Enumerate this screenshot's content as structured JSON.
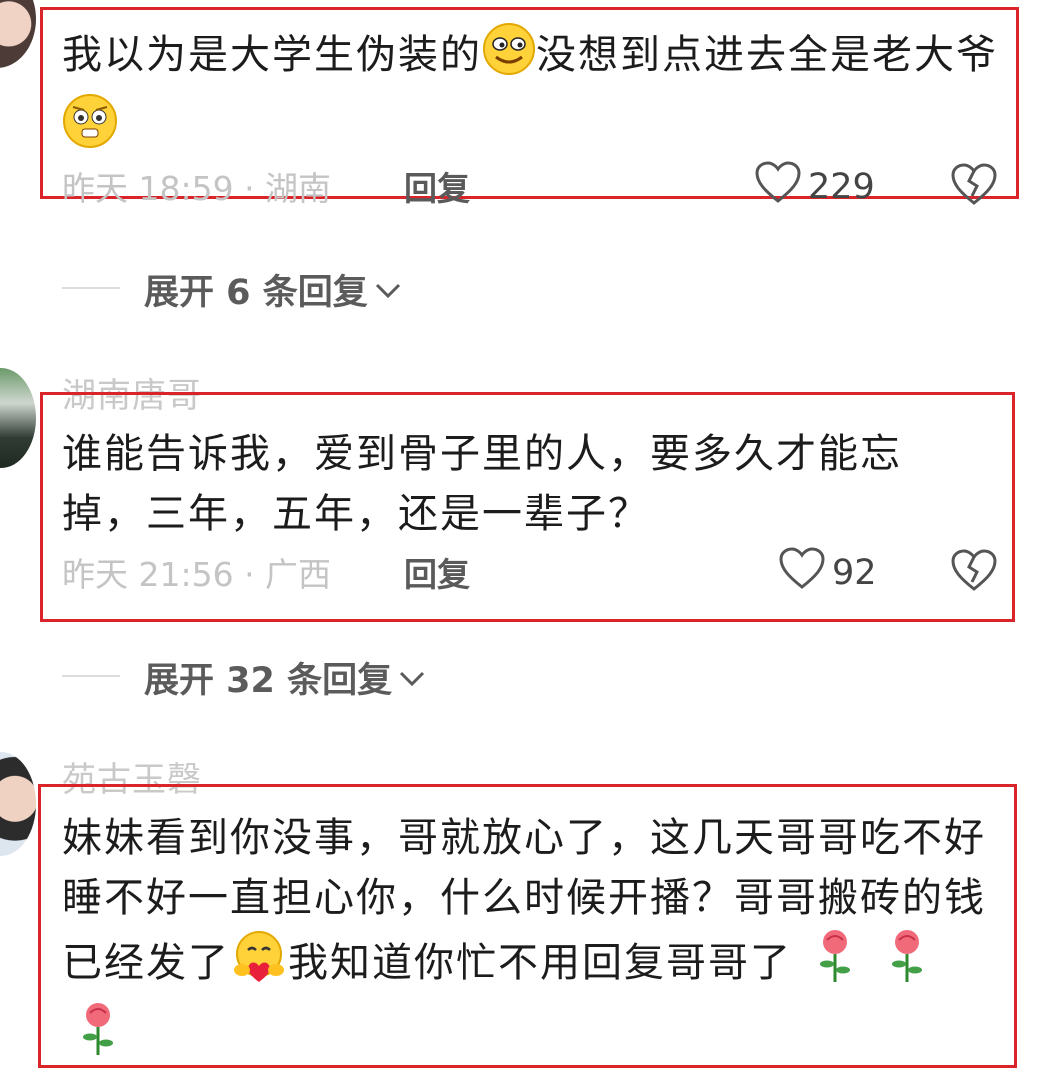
{
  "comments": [
    {
      "username": "",
      "text_parts": [
        "我以为是大学生伪装的",
        "没想到点进去全是老大爷"
      ],
      "emoji_icons": [
        "smirk-face-emoji",
        "pleading-face-emoji"
      ],
      "meta": "昨天 18:59 · 湖南",
      "reply_label": "回复",
      "likes": "229",
      "expand_label": "展开 6 条回复"
    },
    {
      "username": "湖南唐哥",
      "text": "谁能告诉我，爱到骨子里的人，要多久才能忘掉，三年，五年，还是一辈子？",
      "meta": "昨天 21:56 · 广西",
      "reply_label": "回复",
      "likes": "92",
      "expand_label": "展开 32 条回复"
    },
    {
      "username": "苑古玉磬",
      "text_parts": [
        "妹妹看到你没事，哥就放心了，这几天哥哥吃不好睡不好一直担心你，什么时候开播？哥哥搬砖的钱已经发了",
        "我知道你忙不用回复哥哥了"
      ],
      "emoji_icons": [
        "hugging-heart-emoji",
        "rose-emoji",
        "rose-emoji",
        "rose-emoji"
      ]
    }
  ],
  "icons": {
    "like": "heart-outline-icon",
    "dislike": "broken-heart-icon",
    "expand_chevron": "chevron-down-icon"
  },
  "colors": {
    "highlight_box": "#d9252a",
    "meta_text": "#c4c4c4",
    "username_text": "#c9c9c9"
  }
}
